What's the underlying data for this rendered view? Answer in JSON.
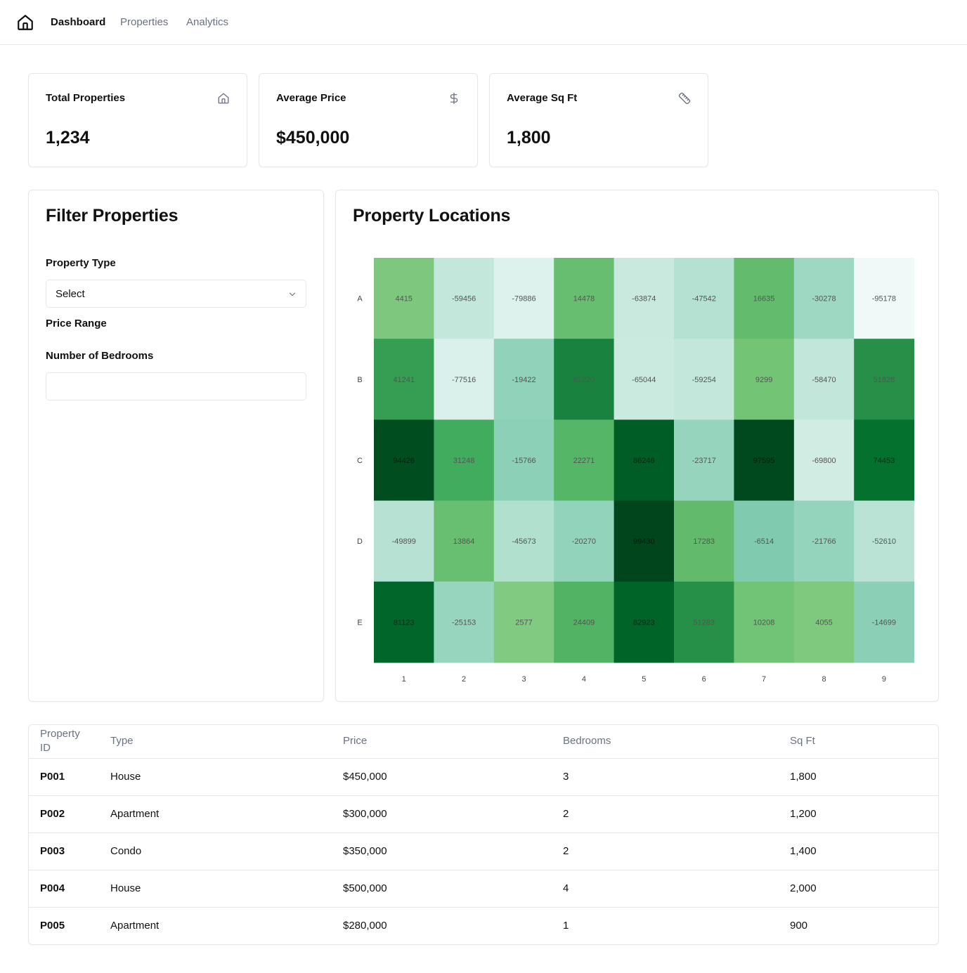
{
  "nav": {
    "logo_icon": "home-icon",
    "links": [
      {
        "label": "Dashboard",
        "active": true
      },
      {
        "label": "Properties",
        "active": false
      },
      {
        "label": "Analytics",
        "active": false
      }
    ]
  },
  "stats": [
    {
      "title": "Total Properties",
      "value": "1,234",
      "icon": "home-icon"
    },
    {
      "title": "Average Price",
      "value": "$450,000",
      "icon": "dollar-icon"
    },
    {
      "title": "Average Sq Ft",
      "value": "1,800",
      "icon": "ruler-icon"
    }
  ],
  "filter": {
    "title": "Filter Properties",
    "property_type_label": "Property Type",
    "property_type_value": "Select",
    "price_range_label": "Price Range",
    "bedrooms_label": "Number of Bedrooms",
    "bedrooms_value": ""
  },
  "map_card": {
    "title": "Property Locations"
  },
  "chart_data": {
    "type": "heatmap",
    "title": "Property Locations",
    "rows": [
      "A",
      "B",
      "C",
      "D",
      "E"
    ],
    "columns": [
      "1",
      "2",
      "3",
      "4",
      "5",
      "6",
      "7",
      "8",
      "9"
    ],
    "values": [
      [
        4415,
        -59456,
        -79886,
        14478,
        -63874,
        -47542,
        16635,
        -30278,
        -95178
      ],
      [
        41241,
        -77516,
        -19422,
        61220,
        -65044,
        -59254,
        9299,
        -58470,
        51828
      ],
      [
        94426,
        31248,
        -15766,
        22271,
        86246,
        -23717,
        97595,
        -69800,
        74453
      ],
      [
        -49899,
        13864,
        -45673,
        -20270,
        99430,
        17283,
        -6514,
        -21766,
        -52610
      ],
      [
        81123,
        -25153,
        2577,
        24409,
        82923,
        51283,
        10208,
        4055,
        -14699
      ]
    ],
    "color_scale": "greens",
    "value_range": [
      -100000,
      100000
    ]
  },
  "table": {
    "columns": [
      "Property ID",
      "Type",
      "Price",
      "Bedrooms",
      "Sq Ft"
    ],
    "rows": [
      [
        "P001",
        "House",
        "$450,000",
        "3",
        "1,800"
      ],
      [
        "P002",
        "Apartment",
        "$300,000",
        "2",
        "1,200"
      ],
      [
        "P003",
        "Condo",
        "$350,000",
        "2",
        "1,400"
      ],
      [
        "P004",
        "House",
        "$500,000",
        "4",
        "2,000"
      ],
      [
        "P005",
        "Apartment",
        "$280,000",
        "1",
        "900"
      ]
    ]
  }
}
